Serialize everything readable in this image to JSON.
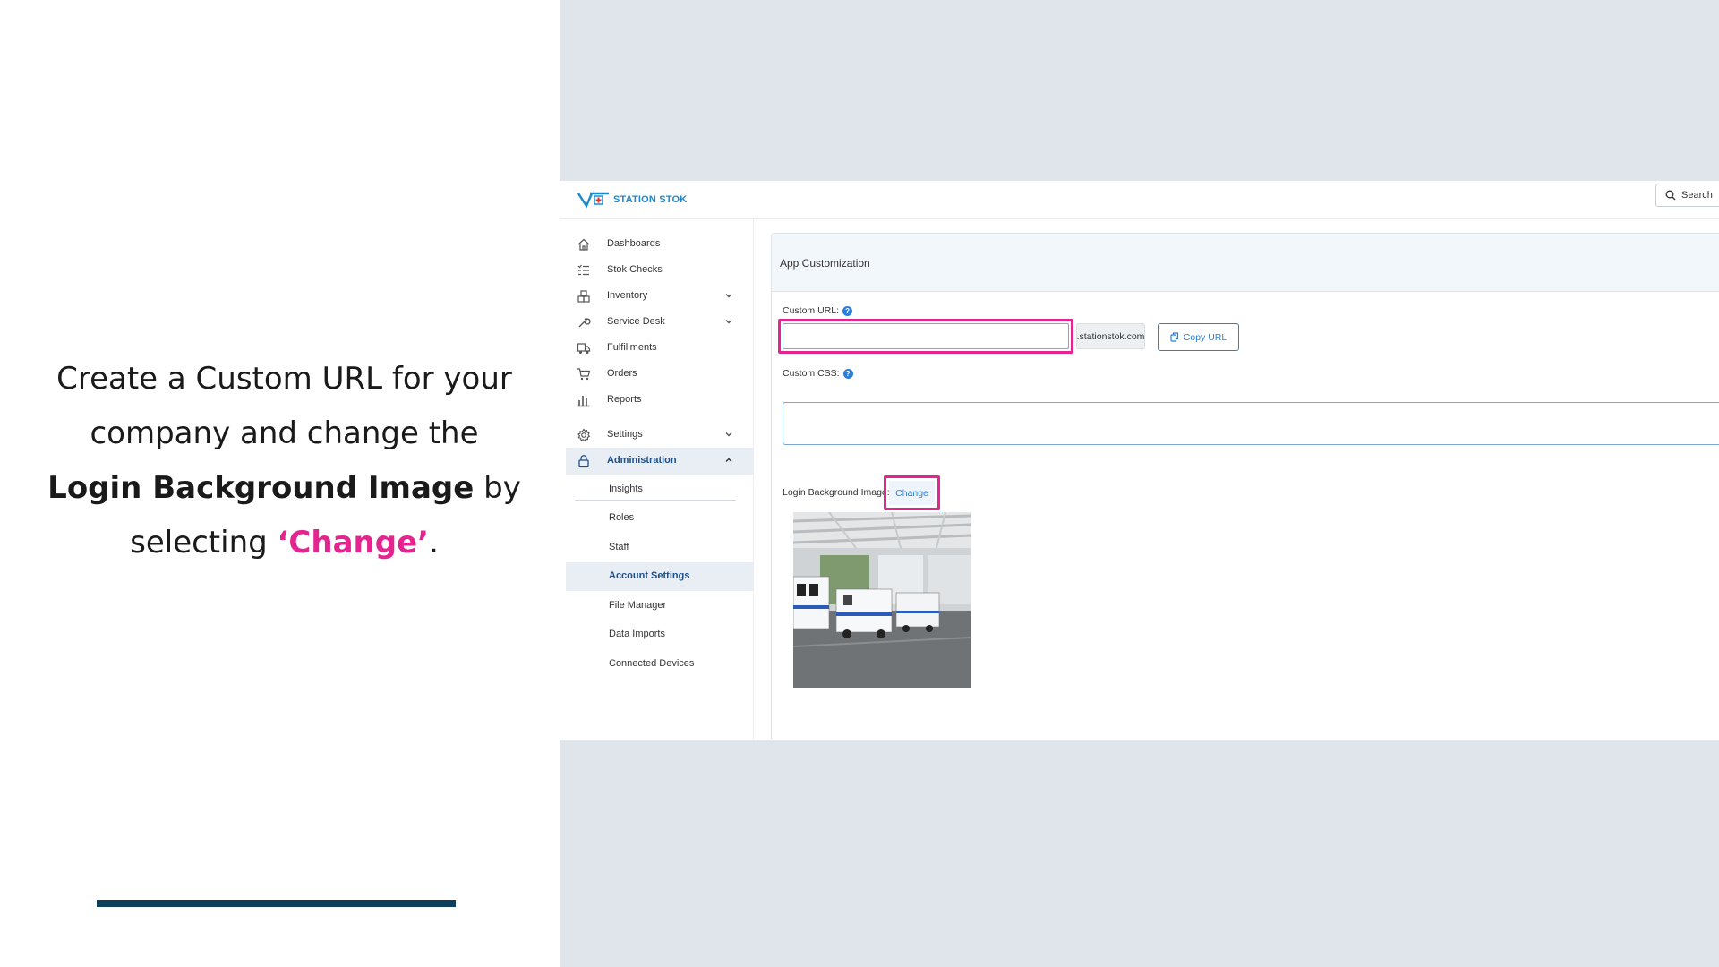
{
  "caption": {
    "line1": "Create a Custom URL for your",
    "line2": "company and change the",
    "bold_text": "Login Background Image",
    "after_bold": " by",
    "line4_prefix": "selecting ",
    "highlight": "‘Change’",
    "line4_suffix": "."
  },
  "app": {
    "logo_text": "STATION STOK",
    "search_label": "Search",
    "sidebar": {
      "items": [
        {
          "label": "Dashboards",
          "icon": "home-icon"
        },
        {
          "label": "Stok Checks",
          "icon": "checklist-icon"
        },
        {
          "label": "Inventory",
          "icon": "inventory-icon",
          "expandable": true
        },
        {
          "label": "Service Desk",
          "icon": "wrench-icon",
          "expandable": true
        },
        {
          "label": "Fulfillments",
          "icon": "truck-icon"
        },
        {
          "label": "Orders",
          "icon": "cart-icon"
        },
        {
          "label": "Reports",
          "icon": "bar-chart-icon"
        },
        {
          "label": "Settings",
          "icon": "gear-icon",
          "expandable": true
        },
        {
          "label": "Administration",
          "icon": "lock-icon",
          "expanded": true,
          "active": true
        }
      ],
      "admin_subitems": [
        {
          "label": "Insights"
        },
        {
          "label": "Roles"
        },
        {
          "label": "Staff"
        },
        {
          "label": "Account Settings",
          "active": true
        },
        {
          "label": "File Manager"
        },
        {
          "label": "Data Imports"
        },
        {
          "label": "Connected Devices"
        }
      ]
    },
    "card": {
      "title": "App Customization",
      "custom_url_label": "Custom URL:",
      "custom_url_value": "",
      "url_suffix": ".stationstok.com",
      "copy_url_label": "Copy URL",
      "custom_css_label": "Custom CSS:",
      "custom_css_value": "",
      "login_bg_label": "Login Background Image:",
      "change_label": "Change",
      "help_glyph": "?"
    }
  },
  "colors": {
    "accent_pink": "#e5258f",
    "brand_blue": "#2b7fd8",
    "active_nav": "#1f4f8a",
    "footer_bar": "#0f3f5b",
    "gray_bg": "#dfe5ea"
  }
}
